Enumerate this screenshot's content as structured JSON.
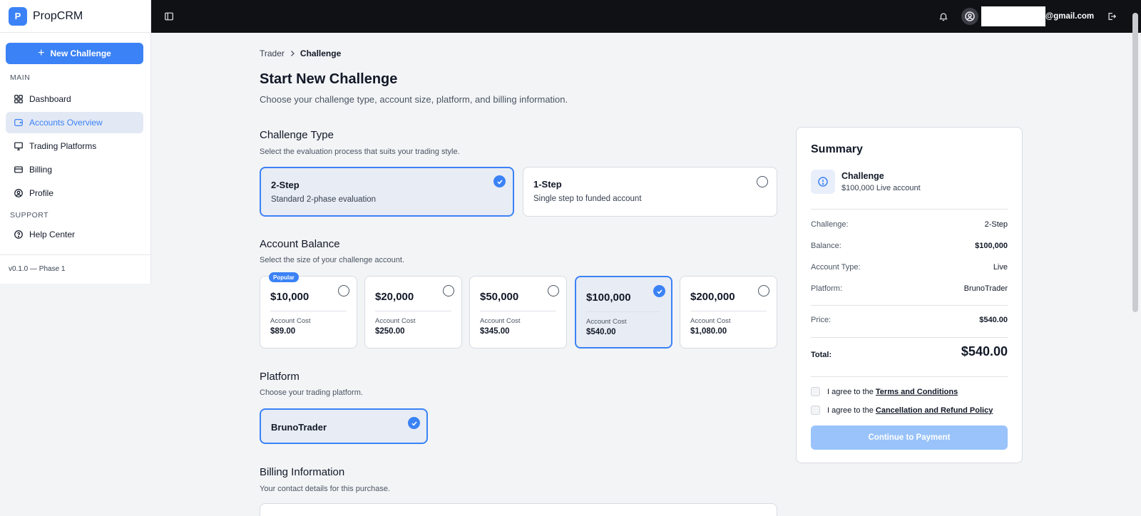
{
  "brand": {
    "logo_letter": "P",
    "name": "PropCRM"
  },
  "sidebar": {
    "new_challenge_label": "New Challenge",
    "main_label": "MAIN",
    "support_label": "SUPPORT",
    "items": [
      {
        "label": "Dashboard",
        "icon": "grid-icon"
      },
      {
        "label": "Accounts Overview",
        "icon": "wallet-icon",
        "active": true
      },
      {
        "label": "Trading Platforms",
        "icon": "monitor-icon"
      },
      {
        "label": "Billing",
        "icon": "credit-card-icon"
      },
      {
        "label": "Profile",
        "icon": "user-circle-icon"
      }
    ],
    "support_items": [
      {
        "label": "Help Center",
        "icon": "help-circle-icon"
      }
    ],
    "version": "v0.1.0 — Phase 1"
  },
  "topbar": {
    "email_suffix": "@gmail.com"
  },
  "breadcrumb": {
    "parent": "Trader",
    "current": "Challenge"
  },
  "page": {
    "title": "Start New Challenge",
    "subtitle": "Choose your challenge type, account size, platform, and billing information."
  },
  "challenge_type": {
    "title": "Challenge Type",
    "subtitle": "Select the evaluation process that suits your trading style.",
    "options": [
      {
        "title": "2-Step",
        "desc": "Standard 2-phase evaluation",
        "selected": true
      },
      {
        "title": "1-Step",
        "desc": "Single step to funded account",
        "selected": false
      }
    ]
  },
  "account_balance": {
    "title": "Account Balance",
    "subtitle": "Select the size of your challenge account.",
    "cost_label": "Account Cost",
    "popular_label": "Popular",
    "options": [
      {
        "amount": "$10,000",
        "cost": "$89.00",
        "selected": false
      },
      {
        "amount": "$20,000",
        "cost": "$250.00",
        "selected": false
      },
      {
        "amount": "$50,000",
        "cost": "$345.00",
        "selected": false
      },
      {
        "amount": "$100,000",
        "cost": "$540.00",
        "selected": true
      },
      {
        "amount": "$200,000",
        "cost": "$1,080.00",
        "selected": false
      }
    ]
  },
  "platform": {
    "title": "Platform",
    "subtitle": "Choose your trading platform.",
    "options": [
      {
        "name": "BrunoTrader",
        "selected": true
      }
    ]
  },
  "billing": {
    "title": "Billing Information",
    "subtitle": "Your contact details for this purchase."
  },
  "summary": {
    "title": "Summary",
    "challenge_title": "Challenge",
    "challenge_sub": "$100,000 Live account",
    "rows": [
      {
        "label": "Challenge:",
        "value": "2-Step"
      },
      {
        "label": "Balance:",
        "value": "$100,000"
      },
      {
        "label": "Account Type:",
        "value": "Live"
      },
      {
        "label": "Platform:",
        "value": "BrunoTrader"
      }
    ],
    "price_label": "Price:",
    "price_value": "$540.00",
    "total_label": "Total:",
    "total_value": "$540.00",
    "agree_prefix": "I agree to the",
    "terms_link": "Terms and Conditions",
    "refund_link": "Cancellation and Refund Policy",
    "continue_label": "Continue to Payment"
  },
  "colors": {
    "accent": "#3b82f6",
    "topbar": "#0f1115",
    "selected_bg": "#e8ecf4",
    "disabled_button": "#99c3fa"
  }
}
